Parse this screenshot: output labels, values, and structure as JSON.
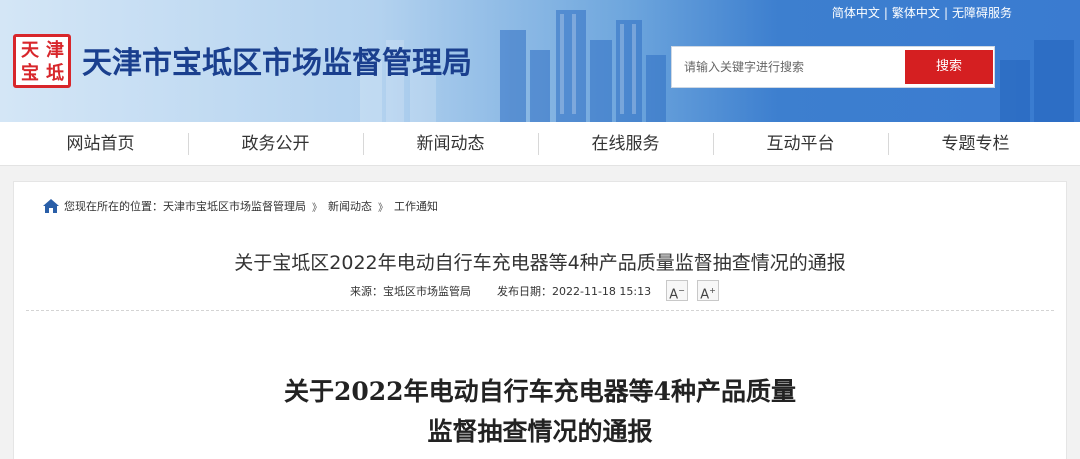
{
  "header": {
    "site_title": "天津市宝坻区市场监督管理局",
    "logo_chars": [
      "天",
      "津",
      "宝",
      "坻"
    ],
    "top_links": [
      "简体中文",
      "繁体中文",
      "无障碍服务"
    ],
    "search": {
      "placeholder": "请输入关键字进行搜索",
      "button_label": "搜索"
    }
  },
  "nav": {
    "items": [
      "网站首页",
      "政务公开",
      "新闻动态",
      "在线服务",
      "互动平台",
      "专题专栏"
    ]
  },
  "breadcrumb": {
    "prefix": "您现在所在的位置：",
    "items": [
      "天津市宝坻区市场监督管理局",
      "新闻动态",
      "工作通知"
    ]
  },
  "article": {
    "title": "关于宝坻区2022年电动自行车充电器等4种产品质量监督抽查情况的通报",
    "source": "来源：宝坻区市场监管局",
    "date": "发布日期：2022-11-18 15:13",
    "font_smaller": "A",
    "font_larger": "A",
    "doc_title_line1": "关于2022年电动自行车充电器等4种产品质量",
    "doc_title_line2": "监督抽查情况的通报"
  },
  "colors": {
    "brand_blue": "#1a3f8e",
    "search_red": "#d51f21",
    "seal_red": "#d8262b"
  },
  "icons": {
    "home": "home-icon",
    "seal": "logo-seal"
  }
}
